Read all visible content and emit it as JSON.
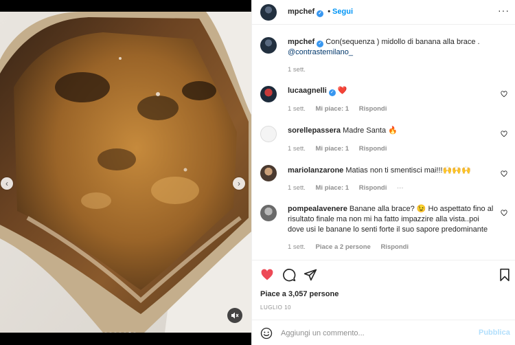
{
  "post": {
    "author": "mpchef",
    "follow_label": "Segui",
    "more_label": "···"
  },
  "caption": {
    "author": "mpchef",
    "text": "Con(sequenza ) midollo di banana alla brace .",
    "mention": "@contrastemilano_",
    "time": "1 sett."
  },
  "comments": [
    {
      "user": "lucaagnelli",
      "text": "❤️",
      "time": "1 sett.",
      "likes": "Mi piace: 1",
      "reply": "Rispondi",
      "verified": true
    },
    {
      "user": "sorellepassera",
      "text": "Madre Santa 🔥",
      "time": "1 sett.",
      "likes": "Mi piace: 1",
      "reply": "Rispondi"
    },
    {
      "user": "mariolanzarone",
      "text": "Matias non ti smentisci mai!!!🙌🙌🙌",
      "time": "1 sett.",
      "likes": "Mi piace: 1",
      "reply": "Rispondi",
      "more": "···"
    },
    {
      "user": "pompealavenere",
      "text": "Banane alla brace? 😉 Ho aspettato fino al risultato finale ma non mi ha fatto impazzire alla vista..poi dove usi le banane lo senti forte il suo sapore predominante",
      "time": "1 sett.",
      "likes": "Piace a 2 persone",
      "reply": "Rispondi"
    }
  ],
  "stats": {
    "likes": "Piace a 3,057 persone",
    "date": "LUGLIO 10"
  },
  "composer": {
    "placeholder": "Aggiungi un commento...",
    "publish_label": "Pubblica"
  },
  "colors": {
    "like_red": "#ed4956",
    "link_blue": "#0095f6",
    "verified_blue": "#3897f0",
    "muted_text": "#8e8e8e"
  },
  "icons": [
    "chevron-left-icon",
    "chevron-right-icon",
    "mute-icon",
    "heart-icon",
    "comment-icon",
    "share-icon",
    "bookmark-icon",
    "emoji-icon",
    "verified-icon",
    "more-icon"
  ],
  "carousel": {
    "slides": 7,
    "active": 6
  }
}
